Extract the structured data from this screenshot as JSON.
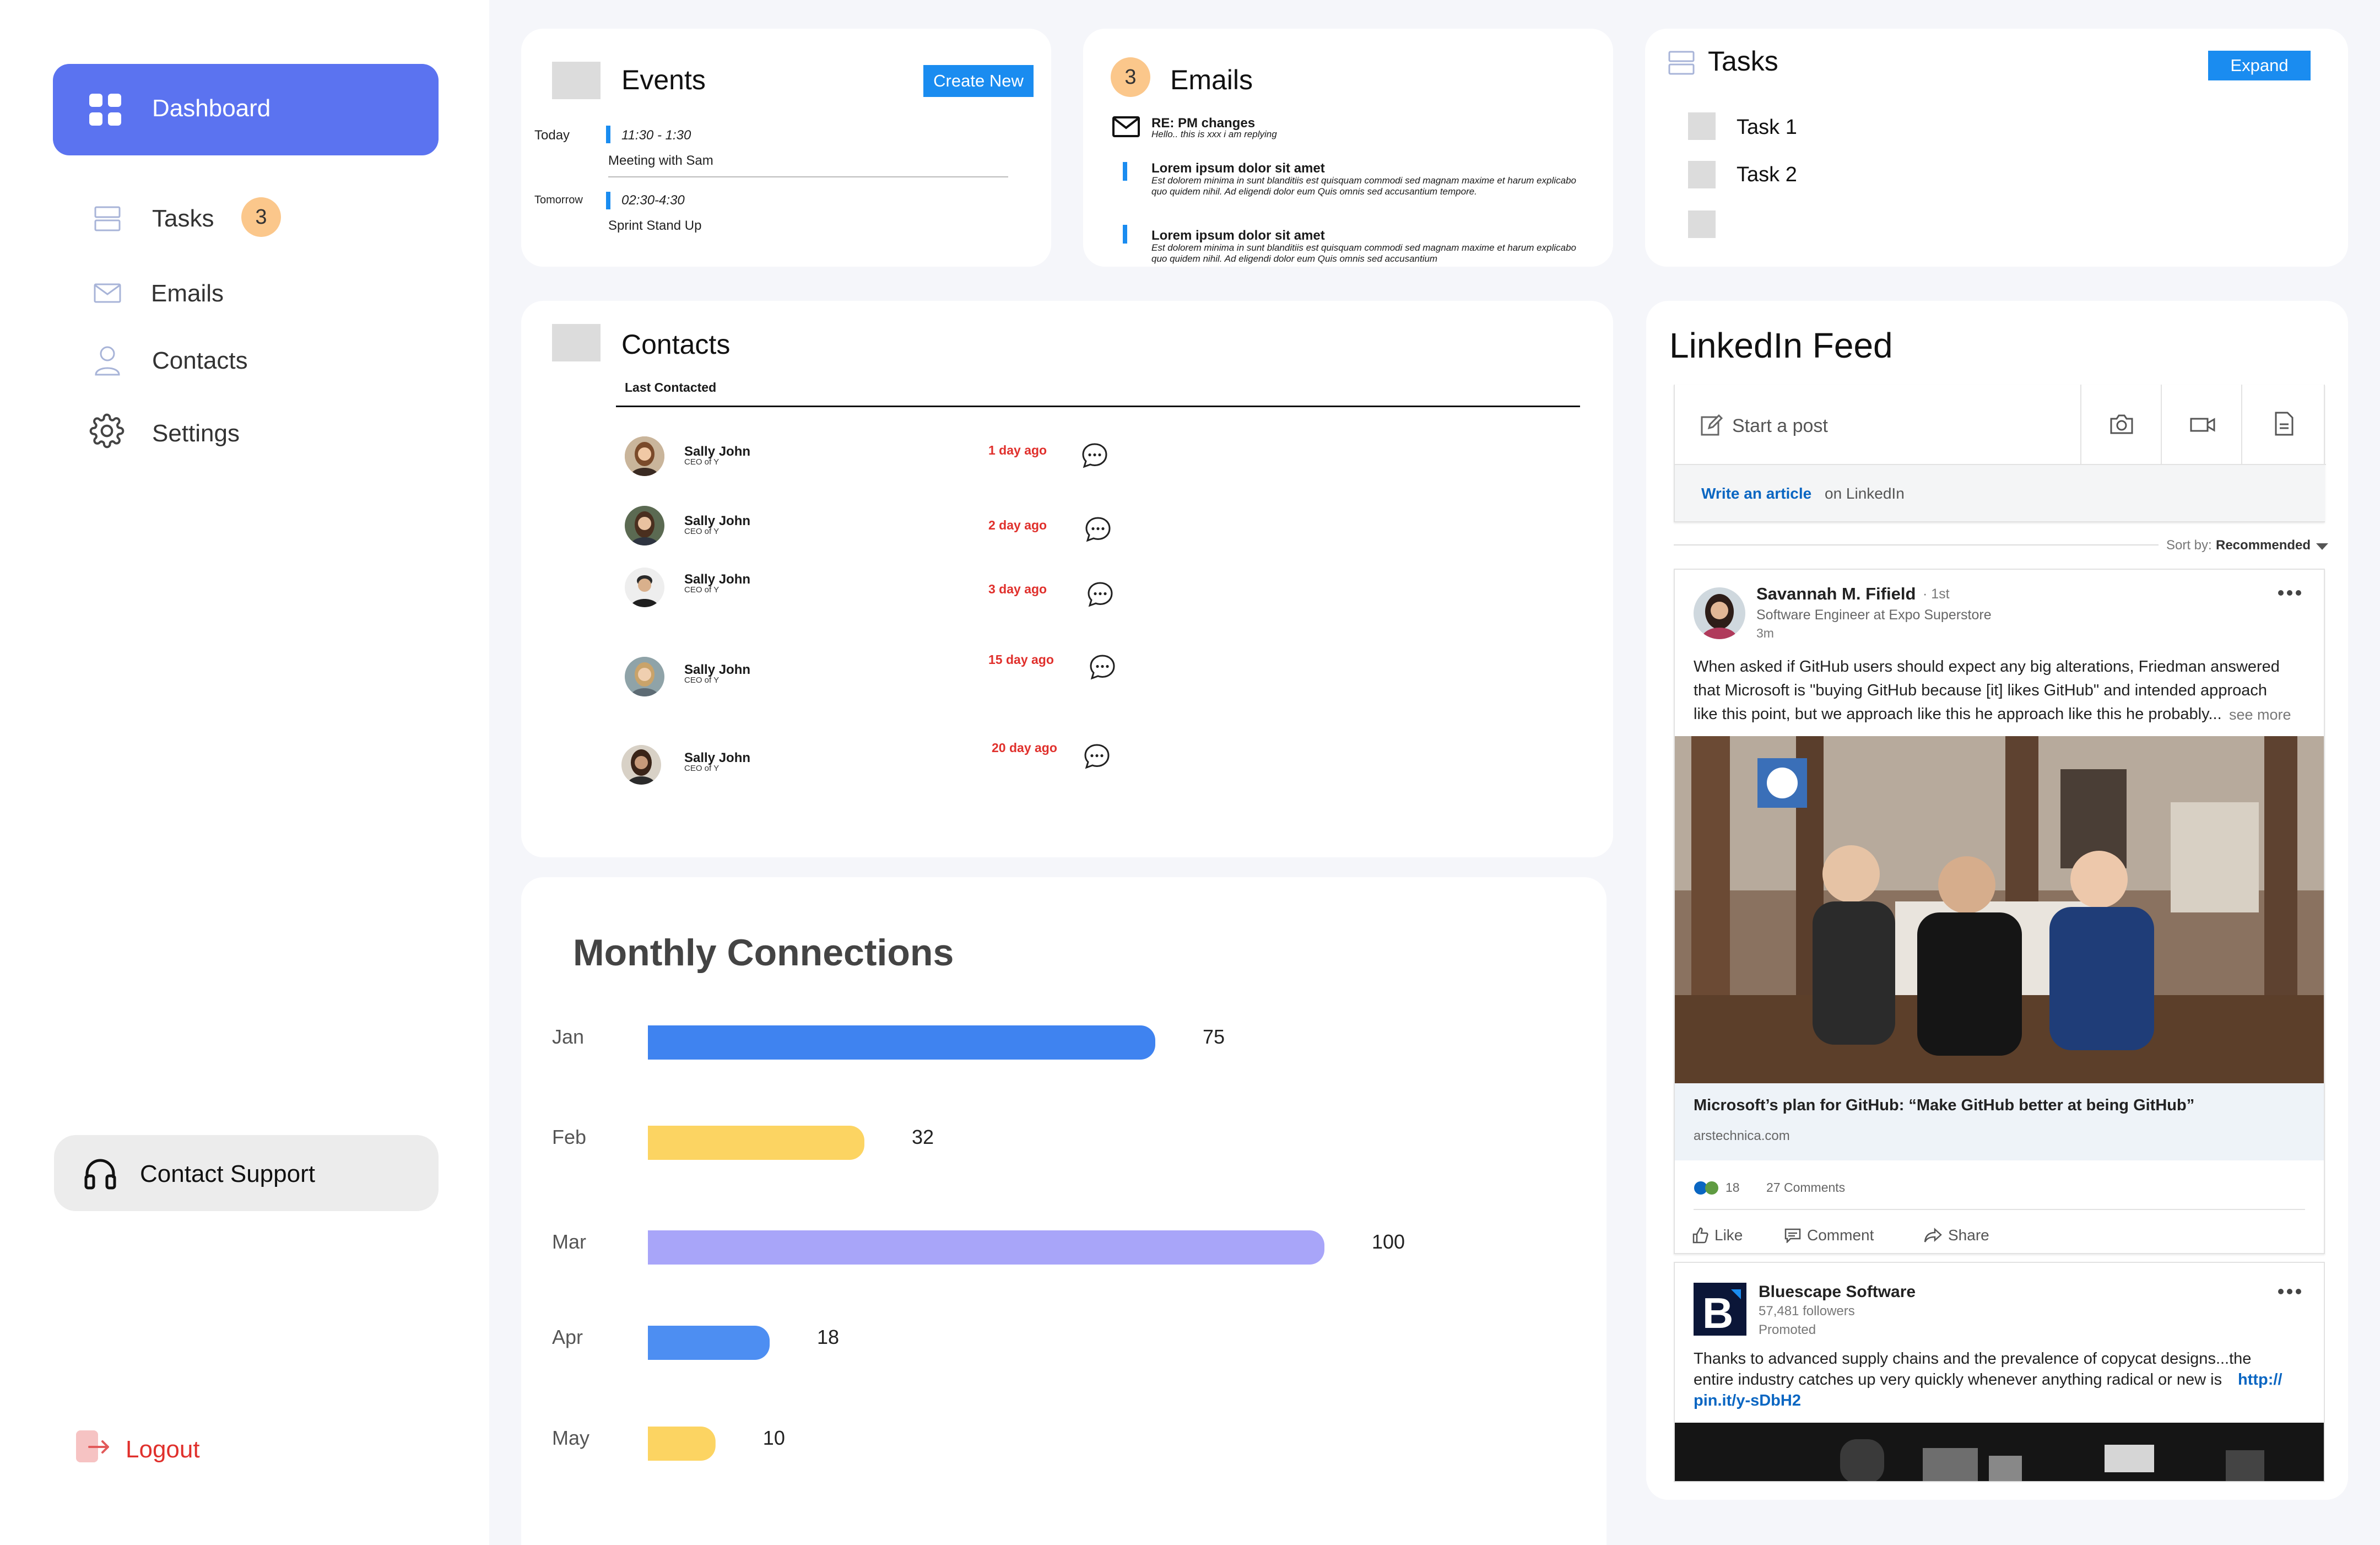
{
  "sidebar": {
    "items": [
      {
        "label": "Dashboard",
        "icon": "dashboard-grid-icon"
      },
      {
        "label": "Tasks",
        "icon": "tasks-icon",
        "badge": "3"
      },
      {
        "label": "Emails",
        "icon": "mail-icon"
      },
      {
        "label": "Contacts",
        "icon": "user-icon"
      },
      {
        "label": "Settings",
        "icon": "gear-icon"
      }
    ],
    "support_label": "Contact Support",
    "logout_label": "Logout"
  },
  "events": {
    "title": "Events",
    "create_label": "Create New",
    "items": [
      {
        "day": "Today",
        "time": "11:30 - 1:30",
        "desc": "Meeting with Sam"
      },
      {
        "day": "Tomorrow",
        "time": "02:30-4:30",
        "desc": "Sprint Stand Up"
      }
    ]
  },
  "emails": {
    "title": "Emails",
    "badge": "3",
    "items": [
      {
        "subject": "RE: PM changes",
        "preview": "Hello.. this is xxx i am replying"
      },
      {
        "subject": "Lorem ipsum dolor sit amet",
        "preview": "Est dolorem minima in sunt blanditiis est quisquam commodi sed magnam maxime et harum explicabo quo quidem nihil. Ad eligendi dolor eum Quis omnis sed accusantium tempore."
      },
      {
        "subject": "Lorem ipsum dolor sit amet",
        "preview": "Est dolorem minima in sunt blanditiis est quisquam commodi sed magnam maxime et harum explicabo quo quidem nihil. Ad eligendi dolor eum Quis omnis sed accusantium"
      }
    ]
  },
  "tasks": {
    "title": "Tasks",
    "expand_label": "Expand",
    "items": [
      "Task 1",
      "Task 2",
      ""
    ]
  },
  "contacts": {
    "title": "Contacts",
    "column": "Last Contacted",
    "items": [
      {
        "name": "Sally John",
        "role": "CEO of Y",
        "ago": "1 day ago"
      },
      {
        "name": "Sally John",
        "role": "CEO of Y",
        "ago": "2 day ago"
      },
      {
        "name": "Sally John",
        "role": "CEO of Y",
        "ago": "3 day ago"
      },
      {
        "name": "Sally John",
        "role": "CEO of Y",
        "ago": "15 day ago"
      },
      {
        "name": "Sally John",
        "role": "CEO of Y",
        "ago": "20 day ago"
      }
    ]
  },
  "chart_data": {
    "type": "bar",
    "orientation": "horizontal",
    "title": "Monthly Connections",
    "categories": [
      "Jan",
      "Feb",
      "Mar",
      "Apr",
      "May"
    ],
    "values": [
      75,
      32,
      100,
      18,
      10
    ],
    "colors": [
      "#3f83f0",
      "#fcd462",
      "#a8a5f9",
      "#4d8ef2",
      "#fcd462"
    ],
    "xlabel": "",
    "ylabel": ""
  },
  "linkedin": {
    "title": "LinkedIn Feed",
    "start_post": "Start a post",
    "write_article": "Write an article",
    "on_linkedin": "on LinkedIn",
    "sort_label": "Sort by:",
    "sort_value": "Recommended",
    "post1": {
      "author": "Savannah M. Fifield",
      "degree": "· 1st",
      "headline": "Software Engineer at Expo Superstore",
      "time": "3m",
      "text_lines": [
        "When asked if GitHub users should expect any big alterations, Friedman answered",
        "that Microsoft is \"buying GitHub because [it] likes GitHub\" and intended approach",
        "like this point, but we approach like this he approach like this he probably..."
      ],
      "see_more": "see more",
      "link_title": "Microsoft’s plan for GitHub: “Make GitHub better at being GitHub”",
      "link_domain": "arstechnica.com",
      "reactions": "18",
      "comments": "27 Comments",
      "actions": [
        "Like",
        "Comment",
        "Share"
      ]
    },
    "post2": {
      "author": "Bluescape Software",
      "followers": "57,481 followers",
      "promoted": "Promoted",
      "text_line1": "Thanks to advanced supply chains and the prevalence of copycat designs...the",
      "text_line2": "entire industry catches up very quickly whenever anything radical or new is",
      "link_part1": "http://",
      "link_part2": "pin.it/y-sDbH2",
      "logo_letter": "B"
    }
  },
  "colors": {
    "accent": "#5b73f0",
    "badge": "#fbc78b",
    "blue_button": "#1a8cf0",
    "red": "#e0302c",
    "linkedin_blue": "#0a66c2"
  }
}
